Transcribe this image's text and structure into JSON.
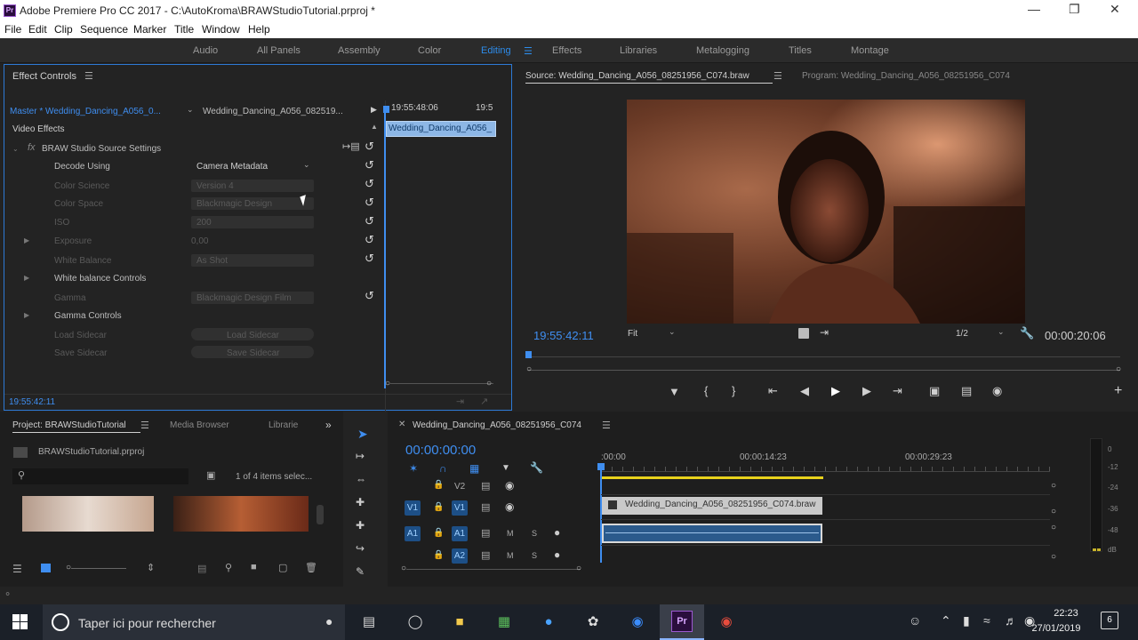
{
  "app": {
    "window_title": "Adobe Premiere Pro CC 2017 - C:\\AutoKroma\\BRAWStudioTutorial.prproj *",
    "icon_label": "Pr"
  },
  "menu": [
    "File",
    "Edit",
    "Clip",
    "Sequence",
    "Marker",
    "Title",
    "Window",
    "Help"
  ],
  "workspaces": {
    "items": [
      "Audio",
      "All Panels",
      "Assembly",
      "Color",
      "Editing",
      "Effects",
      "Libraries",
      "Metalogging",
      "Titles",
      "Montage"
    ],
    "active": "Editing"
  },
  "effect_controls": {
    "title": "Effect Controls",
    "master_clip": "Master * Wedding_Dancing_A056_0...",
    "sequence_clip": "Wedding_Dancing_A056_082519...",
    "time_a": "19:55:48:06",
    "time_b": "19:5",
    "mini_clip": "Wedding_Dancing_A056_",
    "section": "Video Effects",
    "effect_name": "BRAW Studio Source Settings",
    "fx_label": "fx",
    "rows": [
      {
        "label": "Decode Using",
        "value": "Camera Metadata",
        "enabled": true
      },
      {
        "label": "Color Science",
        "value": "Version 4",
        "enabled": false
      },
      {
        "label": "Color Space",
        "value": "Blackmagic Design",
        "enabled": false
      },
      {
        "label": "ISO",
        "value": "200",
        "enabled": false
      },
      {
        "label": "Exposure",
        "value": "0,00",
        "enabled": false
      },
      {
        "label": "White Balance",
        "value": "As Shot",
        "enabled": false
      },
      {
        "label": "White balance Controls",
        "value": "",
        "enabled": true
      },
      {
        "label": "Gamma",
        "value": "Blackmagic Design Film",
        "enabled": false
      },
      {
        "label": "Gamma Controls",
        "value": "",
        "enabled": true
      },
      {
        "label": "Load Sidecar",
        "value": "Load Sidecar",
        "enabled": false
      },
      {
        "label": "Save Sidecar",
        "value": "Save Sidecar",
        "enabled": false
      }
    ],
    "timecode": "19:55:42:11"
  },
  "source_monitor": {
    "tab_source": "Source: Wedding_Dancing_A056_08251956_C074.braw",
    "tab_program": "Program: Wedding_Dancing_A056_08251956_C074",
    "timecode": "19:55:42:11",
    "fit": "Fit",
    "resolution": "1/2",
    "duration": "00:00:20:06"
  },
  "project": {
    "tab_project": "Project: BRAWStudioTutorial",
    "tab_media": "Media Browser",
    "tab_libraries": "Librarie",
    "file": "BRAWStudioTutorial.prproj",
    "selection": "1 of 4 items selec..."
  },
  "timeline": {
    "sequence_tab": "Wedding_Dancing_A056_08251956_C074",
    "timecode": "00:00:00:00",
    "ruler": [
      ":00:00",
      "00:00:14:23",
      "00:00:29:23"
    ],
    "tracks": {
      "v2": "V2",
      "v1": "V1",
      "a1": "A1",
      "a2": "A2",
      "m": "M",
      "s": "S"
    },
    "video_clip": "Wedding_Dancing_A056_08251956_C074.braw"
  },
  "audio_meter": {
    "ticks": [
      "0",
      "-12",
      "-24",
      "-36",
      "-48",
      "dB"
    ]
  },
  "taskbar": {
    "search_placeholder": "Taper ici pour rechercher",
    "time": "22:23",
    "date": "27/01/2019",
    "notif_count": "6"
  }
}
